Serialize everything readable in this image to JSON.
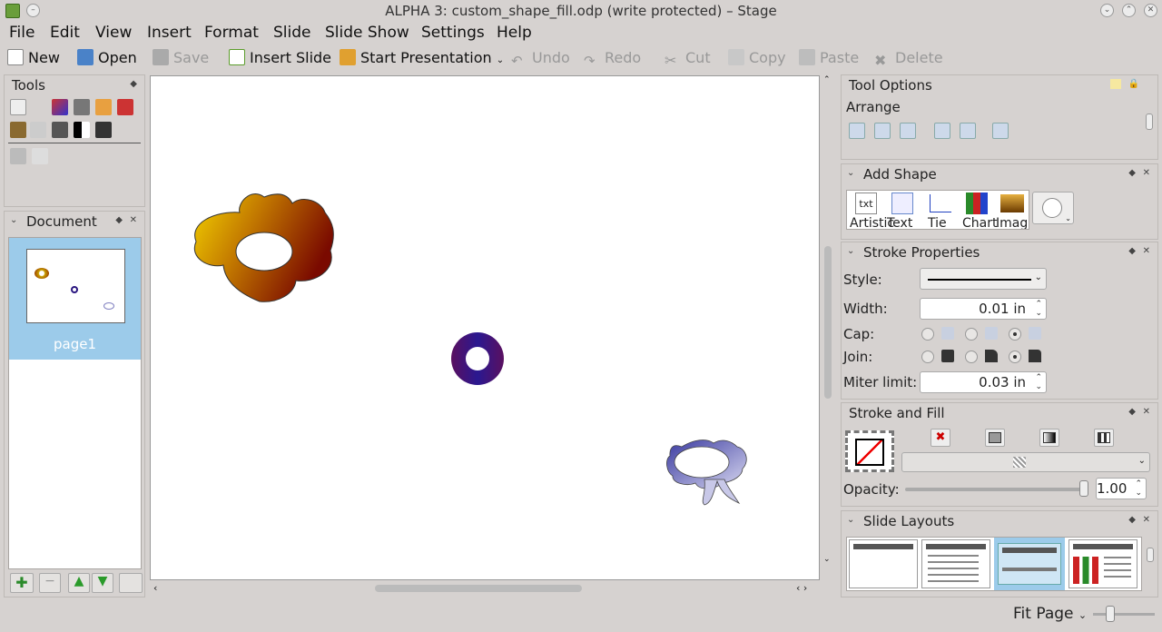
{
  "window": {
    "title": "ALPHA 3: custom_shape_fill.odp (write protected) – Stage"
  },
  "menu": [
    "File",
    "Edit",
    "View",
    "Insert",
    "Format",
    "Slide",
    "Slide Show",
    "Settings",
    "Help"
  ],
  "toolbar": {
    "new": "New",
    "open": "Open",
    "save": "Save",
    "insert_slide": "Insert Slide",
    "start_presentation": "Start Presentation",
    "undo": "Undo",
    "redo": "Redo",
    "cut": "Cut",
    "copy": "Copy",
    "paste": "Paste",
    "delete": "Delete"
  },
  "tools_panel": {
    "title": "Tools"
  },
  "document_panel": {
    "title": "Document",
    "page_label": "page1"
  },
  "tool_options": {
    "title": "Tool Options",
    "section": "Arrange"
  },
  "add_shape": {
    "title": "Add Shape",
    "items": [
      "Artistic",
      "Text",
      "Tie",
      "Chart",
      "Image"
    ]
  },
  "stroke_properties": {
    "title": "Stroke Properties",
    "style_label": "Style:",
    "width_label": "Width:",
    "width_value": "0.01 in",
    "cap_label": "Cap:",
    "join_label": "Join:",
    "miter_label": "Miter limit:",
    "miter_value": "0.03 in"
  },
  "stroke_fill": {
    "title": "Stroke and Fill",
    "opacity_label": "Opacity:",
    "opacity_value": "1.00"
  },
  "slide_layouts": {
    "title": "Slide Layouts"
  },
  "statusbar": {
    "zoom": "Fit Page"
  }
}
